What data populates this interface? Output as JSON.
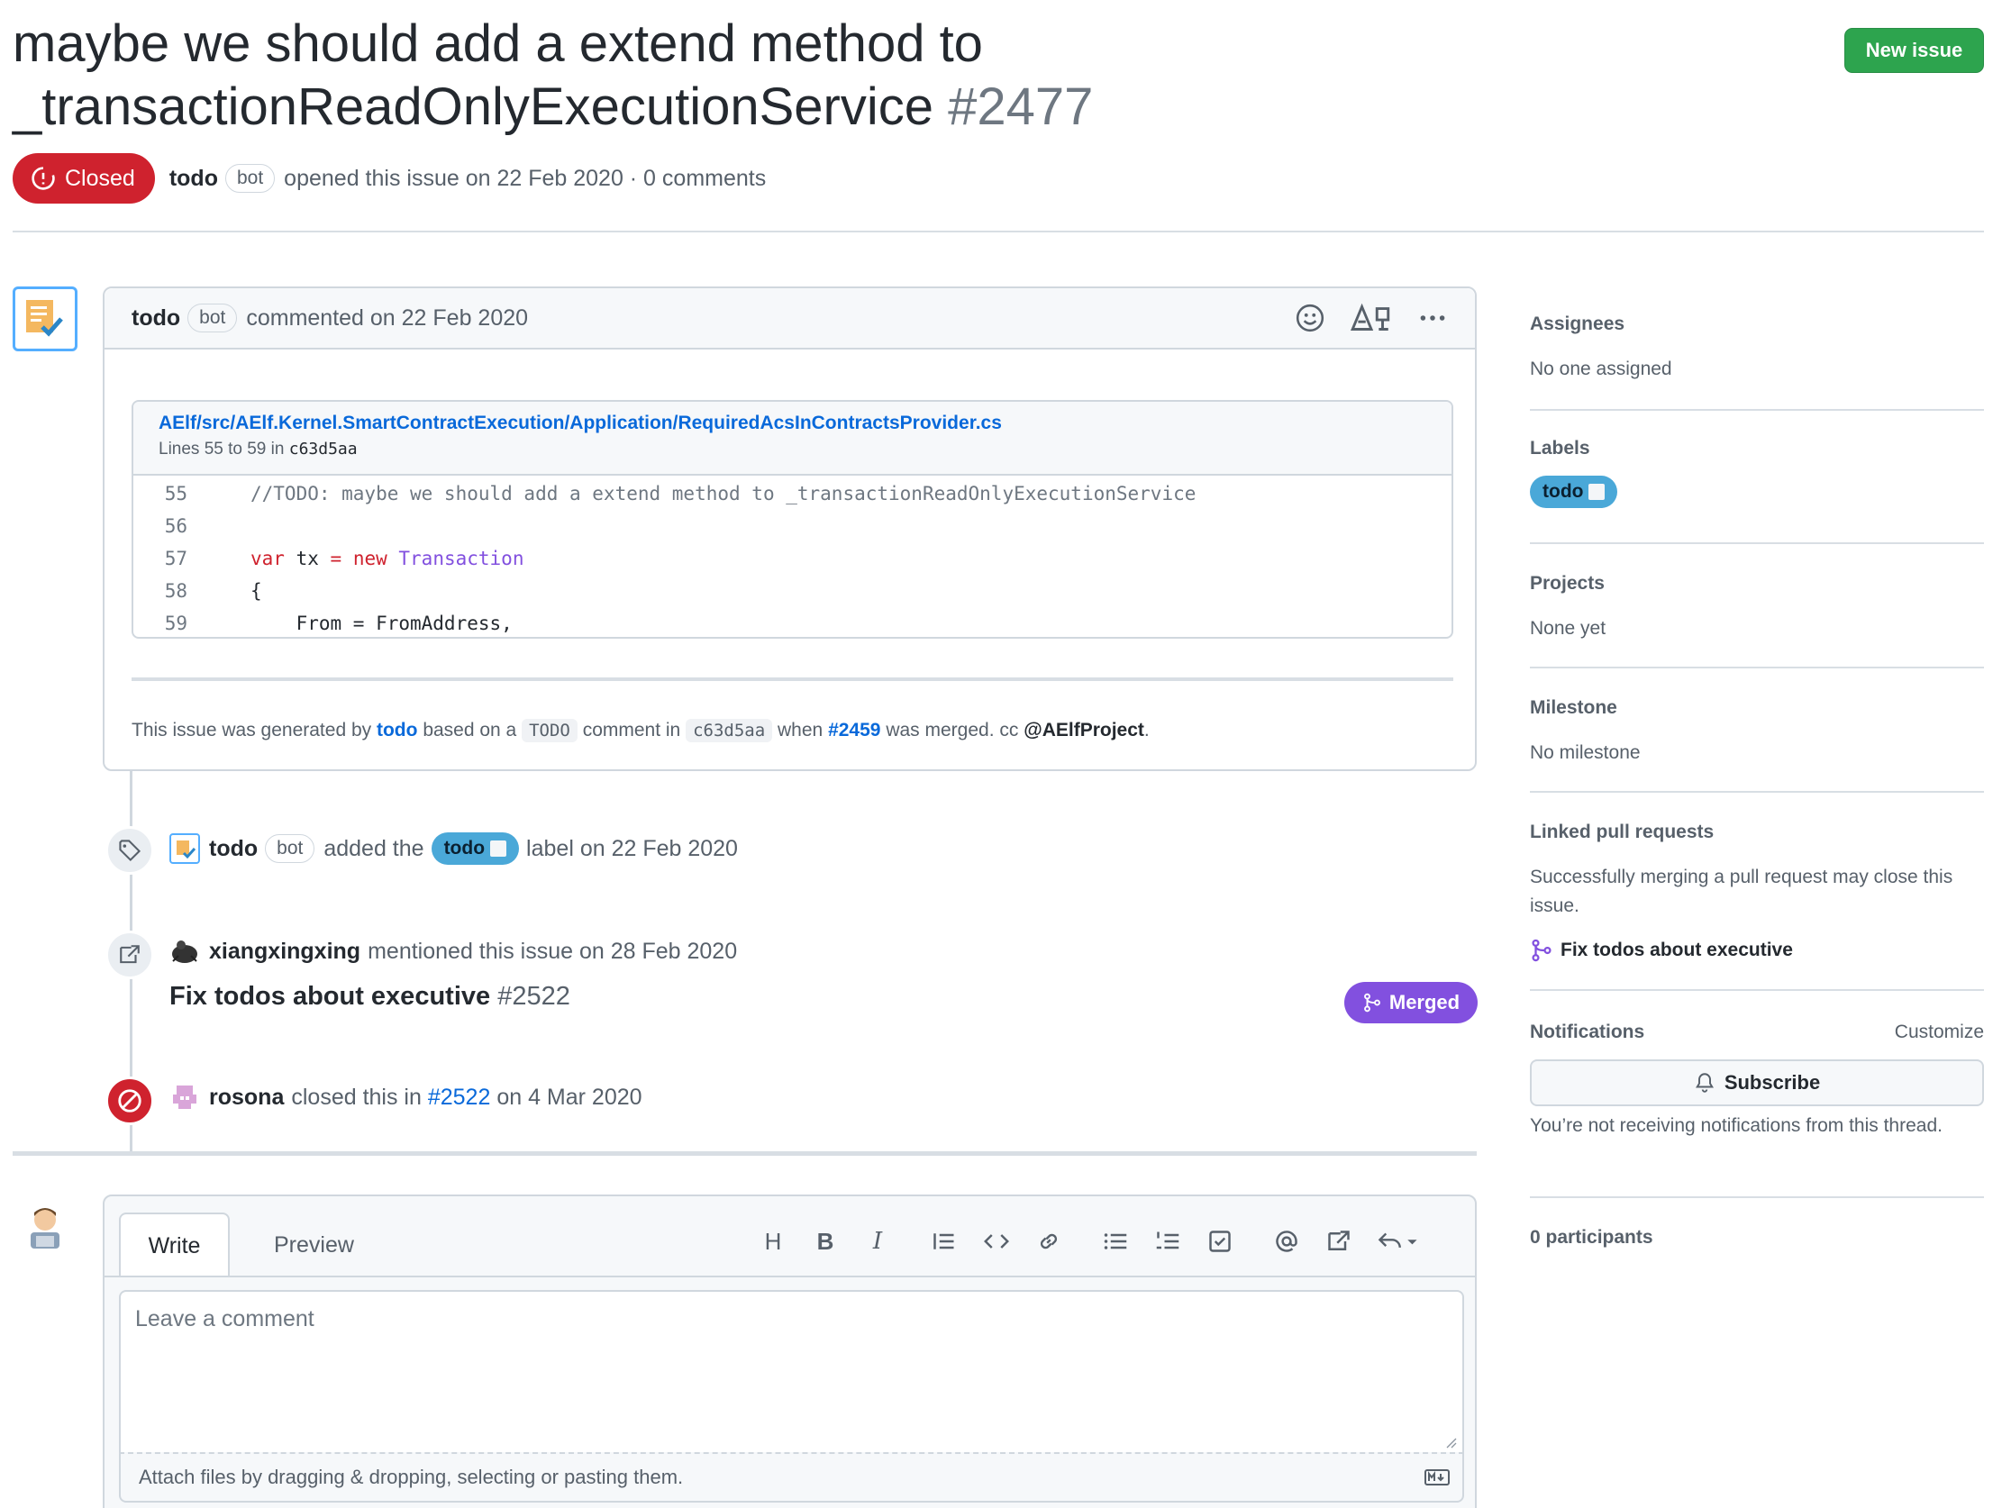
{
  "issue": {
    "title_line1": "maybe we should add a extend method to",
    "title_line2": "_transactionReadOnlyExecutionService",
    "number": "#2477",
    "state": "Closed",
    "author": "todo",
    "bot_tag": "bot",
    "opened_text": "opened this issue on 22 Feb 2020 · 0 comments"
  },
  "header": {
    "new_issue_label": "New issue"
  },
  "comment": {
    "author": "todo",
    "bot_tag": "bot",
    "action": "commented on 22 Feb 2020",
    "snippet": {
      "path": "AElf/src/AElf.Kernel.SmartContractExecution/Application/RequiredAcsInContractsProvider.cs",
      "lines_prefix": "Lines 55 to 59 in",
      "commit": "c63d5aa",
      "code": [
        {
          "ln": "55",
          "text": "//TODO: maybe we should add a extend method to _transactionReadOnlyExecutionService"
        },
        {
          "ln": "56",
          "text": ""
        },
        {
          "ln": "57",
          "kw1": "var",
          "mid": " tx ",
          "op": "=",
          "kw2": " new",
          "ty": " Transaction"
        },
        {
          "ln": "58",
          "text": "{"
        },
        {
          "ln": "59",
          "text": "    From = FromAddress,"
        }
      ]
    },
    "footnote": {
      "t1": "This issue was generated by",
      "todo_link": "todo",
      "t2": "based on a",
      "todo_code": "TODO",
      "t3": "comment in",
      "commit": "c63d5aa",
      "t4": "when",
      "pr": "#2459",
      "t5": "was merged. cc",
      "mention": "@AElfProject",
      "t6": "."
    }
  },
  "timeline": {
    "labeled": {
      "user": "todo",
      "bot_tag": "bot",
      "t1": "added the",
      "label": "todo",
      "t2": "label on 22 Feb 2020"
    },
    "mentioned": {
      "user": "xiangxingxing",
      "t1": "mentioned this issue on 28 Feb 2020",
      "ref_title": "Fix todos about executive",
      "ref_num": "#2522",
      "ref_state": "Merged"
    },
    "closed": {
      "user": "rosona",
      "t1": "closed this in",
      "pr": "#2522",
      "t2": "on 4 Mar 2020"
    }
  },
  "editor": {
    "tab_write": "Write",
    "tab_preview": "Preview",
    "placeholder": "Leave a comment",
    "attach_text": "Attach files by dragging & dropping, selecting or pasting them.",
    "toolbar_heading": "H",
    "toolbar_bold": "B",
    "toolbar_italic": "I"
  },
  "sidebar": {
    "assignees_h": "Assignees",
    "assignees_v": "No one assigned",
    "labels_h": "Labels",
    "label": "todo",
    "projects_h": "Projects",
    "projects_v": "None yet",
    "milestone_h": "Milestone",
    "milestone_v": "No milestone",
    "linked_h": "Linked pull requests",
    "linked_v": "Successfully merging a pull request may close this issue.",
    "linked_pr": "Fix todos about executive",
    "notifications_h": "Notifications",
    "customize": "Customize",
    "subscribe": "Subscribe",
    "notif_v": "You’re not receiving notifications from this thread.",
    "participants": "0 participants"
  },
  "colors": {
    "closed": "#cf222e",
    "merged": "#8250df",
    "new_issue": "#2da44e",
    "label": "#4aa8d8",
    "link": "#0969da"
  }
}
